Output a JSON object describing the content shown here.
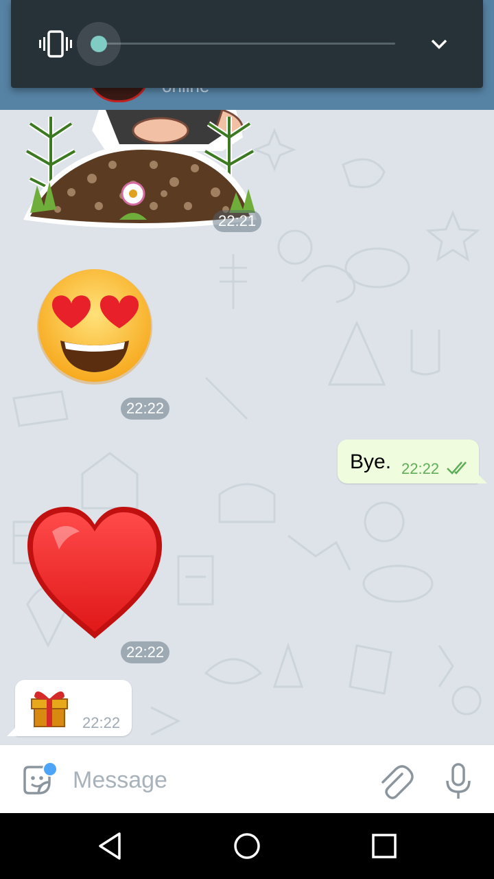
{
  "header": {
    "status": "online"
  },
  "volume_panel": {
    "mode_icon": "vibrate-icon",
    "volume_level": 0.0,
    "expand_icon": "chevron-down-icon"
  },
  "messages": [
    {
      "type": "sticker",
      "direction": "incoming",
      "sticker": "character-behind-dirt-pile",
      "time": "22:21"
    },
    {
      "type": "sticker",
      "direction": "incoming",
      "sticker": "heart-eyes-emoji",
      "time": "22:22"
    },
    {
      "type": "text",
      "direction": "outgoing",
      "text": "Bye.",
      "time": "22:22",
      "status": "read"
    },
    {
      "type": "sticker",
      "direction": "incoming",
      "sticker": "red-heart-emoji",
      "time": "22:22"
    },
    {
      "type": "emoji",
      "direction": "incoming",
      "emoji": "gift-icon",
      "time": "22:22"
    }
  ],
  "input": {
    "placeholder": "Message",
    "sticker_icon": "sticker-icon",
    "attach_icon": "paperclip-icon",
    "mic_icon": "microphone-icon"
  },
  "navbar": {
    "back_icon": "back-triangle-icon",
    "home_icon": "home-circle-icon",
    "recents_icon": "recents-square-icon"
  },
  "colors": {
    "header": "#5682a3",
    "volume_panel": "#263238",
    "slider_accent": "#80cbc4",
    "chat_bg": "#dde3e8",
    "outgoing_bubble": "#effdde",
    "outgoing_time": "#5fae57"
  }
}
